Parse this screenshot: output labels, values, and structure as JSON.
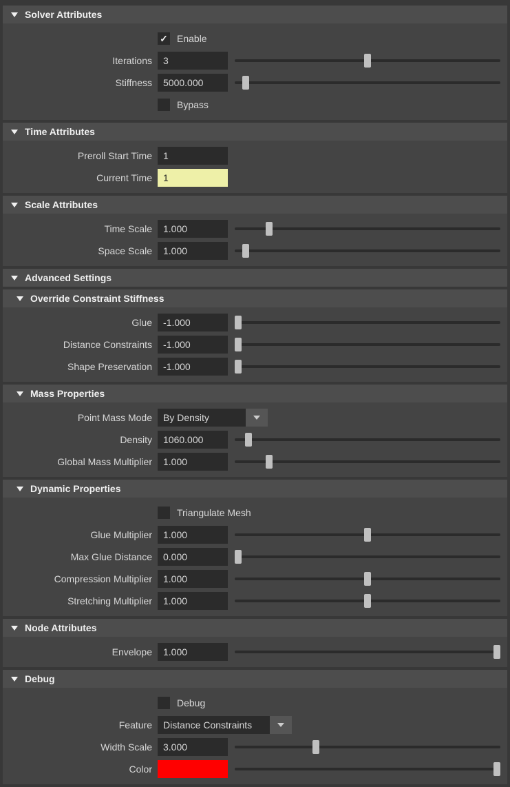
{
  "solver": {
    "title": "Solver Attributes",
    "enable_label": "Enable",
    "enable_checked": true,
    "iterations_label": "Iterations",
    "iterations_value": "3",
    "iterations_slider": 50,
    "stiffness_label": "Stiffness",
    "stiffness_value": "5000.000",
    "stiffness_slider": 3,
    "bypass_label": "Bypass",
    "bypass_checked": false
  },
  "time": {
    "title": "Time Attributes",
    "preroll_label": "Preroll Start Time",
    "preroll_value": "1",
    "current_label": "Current Time",
    "current_value": "1"
  },
  "scale": {
    "title": "Scale Attributes",
    "time_label": "Time Scale",
    "time_value": "1.000",
    "time_slider": 12,
    "space_label": "Space Scale",
    "space_value": "1.000",
    "space_slider": 3
  },
  "advanced": {
    "title": "Advanced Settings",
    "override": {
      "title": "Override Constraint Stiffness",
      "glue_label": "Glue",
      "glue_value": "-1.000",
      "glue_slider": 0,
      "dist_label": "Distance Constraints",
      "dist_value": "-1.000",
      "dist_slider": 0,
      "shape_label": "Shape Preservation",
      "shape_value": "-1.000",
      "shape_slider": 0
    },
    "mass": {
      "title": "Mass Properties",
      "mode_label": "Point Mass Mode",
      "mode_value": "By Density",
      "density_label": "Density",
      "density_value": "1060.000",
      "density_slider": 4,
      "mult_label": "Global Mass Multiplier",
      "mult_value": "1.000",
      "mult_slider": 12
    },
    "dynamic": {
      "title": "Dynamic Properties",
      "tri_label": "Triangulate Mesh",
      "tri_checked": false,
      "glue_label": "Glue Multiplier",
      "glue_value": "1.000",
      "glue_slider": 50,
      "maxglue_label": "Max Glue Distance",
      "maxglue_value": "0.000",
      "maxglue_slider": 0,
      "comp_label": "Compression Multiplier",
      "comp_value": "1.000",
      "comp_slider": 50,
      "stretch_label": "Stretching Multiplier",
      "stretch_value": "1.000",
      "stretch_slider": 50
    }
  },
  "node": {
    "title": "Node Attributes",
    "env_label": "Envelope",
    "env_value": "1.000",
    "env_slider": 100
  },
  "debug": {
    "title": "Debug",
    "debug_label": "Debug",
    "debug_checked": false,
    "feature_label": "Feature",
    "feature_value": "Distance Constraints",
    "ws_label": "Width Scale",
    "ws_value": "3.000",
    "ws_slider": 30,
    "color_label": "Color",
    "color_value": "#ff0000",
    "color_slider": 100
  }
}
